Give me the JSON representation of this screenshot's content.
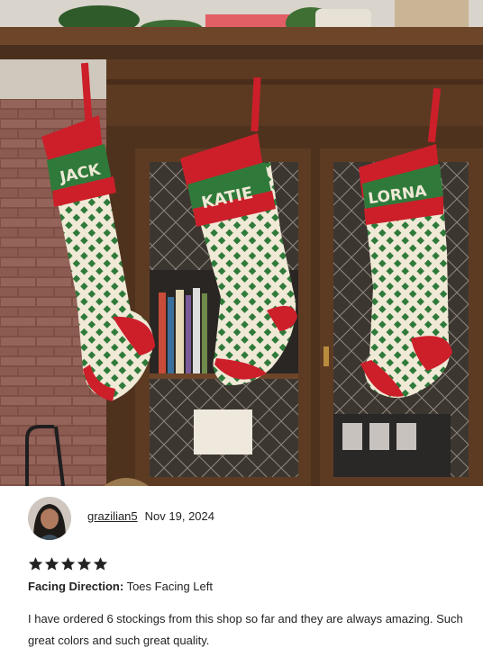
{
  "photo": {
    "description_alt": "",
    "stocking_names": [
      "JACK",
      "KATIE",
      "LORNA"
    ]
  },
  "review": {
    "username": "grazilian5",
    "date": "Nov 19, 2024",
    "rating": 5,
    "rating_max": 5,
    "attribute_label": "Facing Direction:",
    "attribute_value": "Toes Facing Left",
    "text": "I have ordered 6 stockings from this shop so far and they are always amazing. Such great colors and such great quality."
  },
  "colors": {
    "stocking_green": "#2f7a3a",
    "stocking_red": "#cc1f2a",
    "stocking_cream": "#efe9d6",
    "wood": "#5a3a22",
    "brick": "#8a5a4e"
  }
}
